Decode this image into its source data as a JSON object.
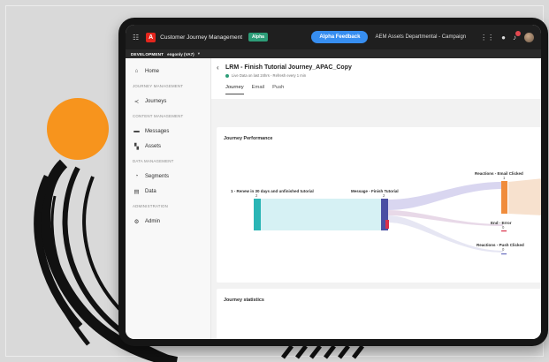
{
  "topbar": {
    "app_title": "Customer Journey Management",
    "alpha_badge": "Alpha",
    "feedback_button": "Alpha Feedback",
    "sandbox": "AEM Assets Departmental - Campaign",
    "icons": [
      "grid-icon",
      "adobe-logo",
      "apps-icon",
      "help-icon",
      "bell-icon",
      "avatar"
    ]
  },
  "env": {
    "label": "DEVELOPMENT",
    "name": "engonly (VA7)"
  },
  "sidebar": {
    "items": [
      {
        "type": "item",
        "label": "Home",
        "icon": "home-icon",
        "glyph": "⌂"
      },
      {
        "type": "section",
        "label": "JOURNEY MANAGEMENT"
      },
      {
        "type": "item",
        "label": "Journeys",
        "icon": "journey-icon",
        "glyph": "≺"
      },
      {
        "type": "section",
        "label": "CONTENT MANAGEMENT"
      },
      {
        "type": "item",
        "label": "Messages",
        "icon": "message-icon",
        "glyph": "▬"
      },
      {
        "type": "item",
        "label": "Assets",
        "icon": "assets-icon",
        "glyph": "▚"
      },
      {
        "type": "section",
        "label": "DATA MANAGEMENT"
      },
      {
        "type": "item",
        "label": "Segments",
        "icon": "segments-icon",
        "glyph": "◔"
      },
      {
        "type": "item",
        "label": "Data",
        "icon": "data-icon",
        "glyph": "▤"
      },
      {
        "type": "section",
        "label": "ADMINISTRATION"
      },
      {
        "type": "item",
        "label": "Admin",
        "icon": "admin-icon",
        "glyph": "⚙"
      }
    ]
  },
  "header": {
    "title": "LRM - Finish Tutorial Journey_APAC_Copy",
    "live_text": "Live Data on last 24hrs - Refresh every 1 min",
    "tabs": [
      {
        "label": "Journey",
        "active": true
      },
      {
        "label": "Email",
        "active": false
      },
      {
        "label": "Push",
        "active": false
      }
    ]
  },
  "performance": {
    "title": "Journey Performance",
    "nodes": [
      {
        "label": "1 - Renew in 30 days and unfinished tutorial",
        "count": "2",
        "color": "#2ab5b5"
      },
      {
        "label": "Message - Finish Tutorial",
        "count": "2",
        "color": "#4a4fa3"
      },
      {
        "label": "Reactions - Email Clicked",
        "count": "1",
        "color": "#f08c3c"
      },
      {
        "label": "End - Error",
        "count": "0",
        "color": "#d9304a"
      },
      {
        "label": "Reactions - Push Clicked",
        "count": "0",
        "color": "#6a6fc0"
      }
    ]
  },
  "statistics": {
    "title": "Journey statistics"
  },
  "colors": {
    "orange_circle": "#f7941d",
    "feedback": "#378ef0",
    "alpha": "#2d9d78"
  }
}
